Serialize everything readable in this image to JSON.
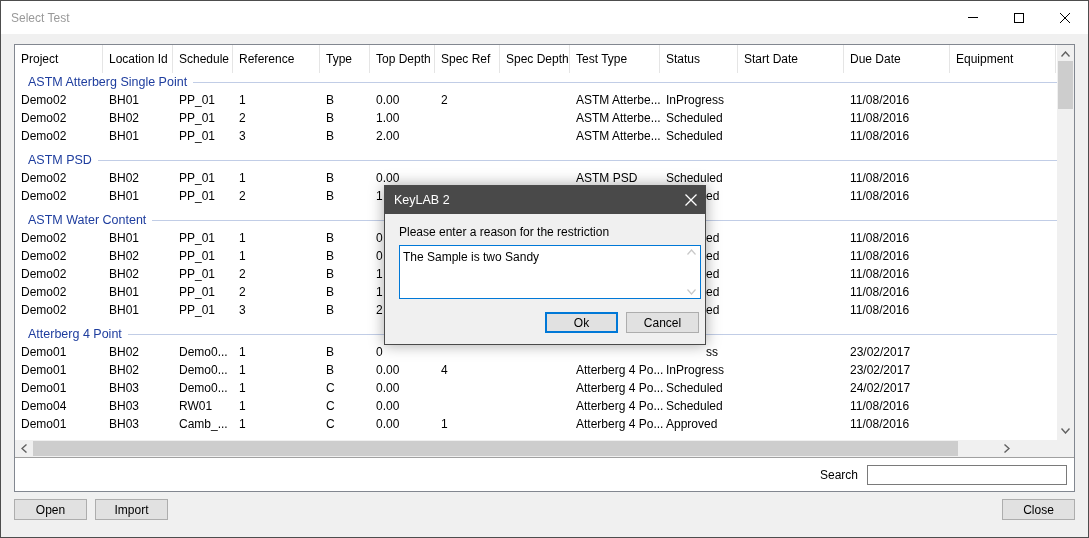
{
  "window": {
    "title": "Select Test"
  },
  "table": {
    "columns": [
      "Project",
      "Location Id",
      "Schedule",
      "Reference",
      "Type",
      "Top Depth",
      "Spec Ref",
      "Spec Depth",
      "Test Type",
      "Status",
      "Start Date",
      "Due Date",
      "Equipment"
    ],
    "groups": [
      {
        "title": "ASTM Atterberg Single Point",
        "rows": [
          {
            "project": "Demo02",
            "location_id": "BH01",
            "schedule": "PP_01",
            "reference": "1",
            "type": "B",
            "top_depth": "0.00",
            "spec_ref": "2",
            "test_type": "ASTM Atterbe...",
            "status": "InProgress",
            "due_date": "11/08/2016"
          },
          {
            "project": "Demo02",
            "location_id": "BH02",
            "schedule": "PP_01",
            "reference": "2",
            "type": "B",
            "top_depth": "1.00",
            "test_type": "ASTM Atterbe...",
            "status": "Scheduled",
            "due_date": "11/08/2016"
          },
          {
            "project": "Demo02",
            "location_id": "BH01",
            "schedule": "PP_01",
            "reference": "3",
            "type": "B",
            "top_depth": "2.00",
            "test_type": "ASTM Atterbe...",
            "status": "Scheduled",
            "due_date": "11/08/2016"
          }
        ]
      },
      {
        "title": "ASTM PSD",
        "rows": [
          {
            "project": "Demo02",
            "location_id": "BH02",
            "schedule": "PP_01",
            "reference": "1",
            "type": "B",
            "top_depth": "0.00",
            "test_type": "ASTM PSD",
            "status": "Scheduled",
            "due_date": "11/08/2016"
          },
          {
            "project": "Demo02",
            "location_id": "BH01",
            "schedule": "PP_01",
            "reference": "2",
            "type": "B",
            "top_depth": "1",
            "status": "ed",
            "status_clipped": true,
            "due_date": "11/08/2016"
          }
        ]
      },
      {
        "title": "ASTM Water Content",
        "rows": [
          {
            "project": "Demo02",
            "location_id": "BH01",
            "schedule": "PP_01",
            "reference": "1",
            "type": "B",
            "top_depth": "0",
            "status": "ed",
            "status_clipped": true,
            "due_date": "11/08/2016"
          },
          {
            "project": "Demo02",
            "location_id": "BH02",
            "schedule": "PP_01",
            "reference": "1",
            "type": "B",
            "top_depth": "0",
            "status": "ed",
            "status_clipped": true,
            "due_date": "11/08/2016"
          },
          {
            "project": "Demo02",
            "location_id": "BH02",
            "schedule": "PP_01",
            "reference": "2",
            "type": "B",
            "top_depth": "1",
            "status": "ed",
            "status_clipped": true,
            "due_date": "11/08/2016"
          },
          {
            "project": "Demo02",
            "location_id": "BH01",
            "schedule": "PP_01",
            "reference": "2",
            "type": "B",
            "top_depth": "1",
            "status": "ed",
            "status_clipped": true,
            "due_date": "11/08/2016"
          },
          {
            "project": "Demo02",
            "location_id": "BH01",
            "schedule": "PP_01",
            "reference": "3",
            "type": "B",
            "top_depth": "2",
            "status": "ed",
            "status_clipped": true,
            "due_date": "11/08/2016"
          }
        ]
      },
      {
        "title": "Atterberg 4 Point",
        "rows": [
          {
            "project": "Demo01",
            "location_id": "BH02",
            "schedule": "Demo0...",
            "reference": "1",
            "type": "B",
            "top_depth": "0",
            "status": "ss",
            "status_clipped": true,
            "due_date": "23/02/2017"
          },
          {
            "project": "Demo01",
            "location_id": "BH02",
            "schedule": "Demo0...",
            "reference": "1",
            "type": "B",
            "top_depth": "0.00",
            "spec_ref": "4",
            "test_type": "Atterberg 4 Po...",
            "status": "InProgress",
            "due_date": "23/02/2017"
          },
          {
            "project": "Demo01",
            "location_id": "BH03",
            "schedule": "Demo0...",
            "reference": "1",
            "type": "C",
            "top_depth": "0.00",
            "test_type": "Atterberg 4 Po...",
            "status": "Scheduled",
            "due_date": "24/02/2017"
          },
          {
            "project": "Demo04",
            "location_id": "BH03",
            "schedule": "RW01",
            "reference": "1",
            "type": "C",
            "top_depth": "0.00",
            "test_type": "Atterberg 4 Po...",
            "status": "Scheduled",
            "due_date": "11/08/2016"
          },
          {
            "project": "Demo01",
            "location_id": "BH03",
            "schedule": "Camb_...",
            "reference": "1",
            "type": "C",
            "top_depth": "0.00",
            "spec_ref": "1",
            "test_type": "Atterberg 4 Po...",
            "status": "Approved",
            "due_date": "11/08/2016"
          }
        ]
      }
    ]
  },
  "search": {
    "label": "Search"
  },
  "buttons": [
    "Open",
    "Import"
  ],
  "close_button": "Close",
  "dialog": {
    "title": "KeyLAB 2",
    "prompt": "Please enter a reason for the restriction",
    "value": "The Sample is two Sandy",
    "buttons": [
      {
        "label": "Ok",
        "default": true
      },
      {
        "label": "Cancel",
        "default": false
      }
    ]
  }
}
